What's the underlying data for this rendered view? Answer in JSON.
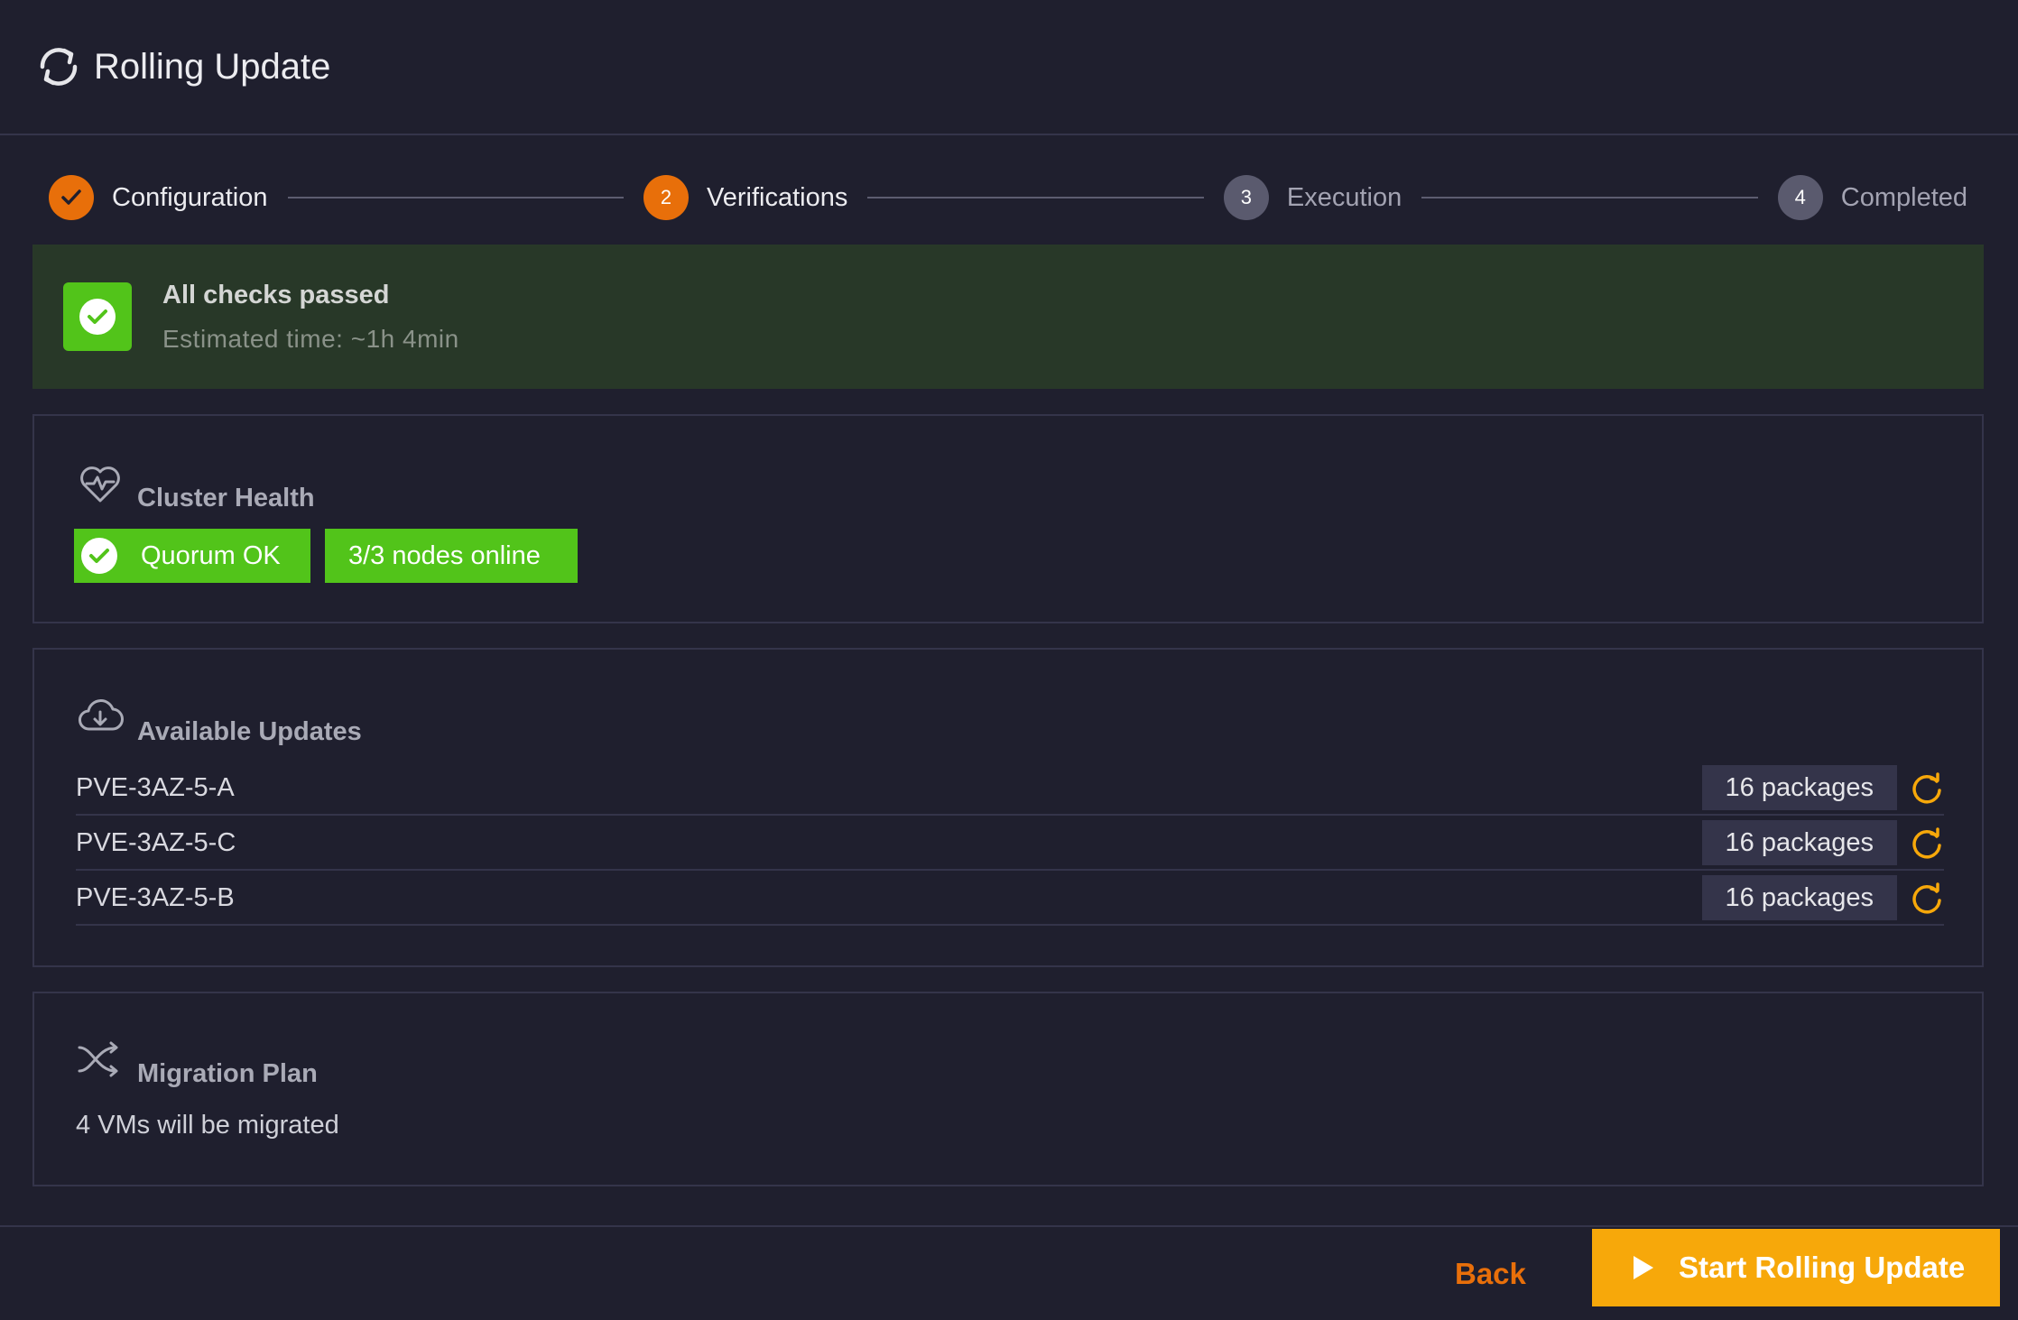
{
  "header": {
    "title": "Rolling Update",
    "icon": "refresh-icon"
  },
  "stepper": {
    "steps": [
      {
        "number": "1",
        "label": "Configuration",
        "state": "done"
      },
      {
        "number": "2",
        "label": "Verifications",
        "state": "active"
      },
      {
        "number": "3",
        "label": "Execution",
        "state": "pending"
      },
      {
        "number": "4",
        "label": "Completed",
        "state": "pending"
      }
    ]
  },
  "banner": {
    "title": "All checks passed",
    "subtitle": "Estimated time: ~1h 4min",
    "icon": "check-circle-icon"
  },
  "cluster_health": {
    "title": "Cluster Health",
    "icon": "heartbeat-icon",
    "quorum_label": "Quorum OK",
    "nodes_label": "3/3 nodes online"
  },
  "available_updates": {
    "title": "Available Updates",
    "icon": "cloud-download-icon",
    "rows": [
      {
        "node": "PVE-3AZ-5-A",
        "packages": "16 packages"
      },
      {
        "node": "PVE-3AZ-5-C",
        "packages": "16 packages"
      },
      {
        "node": "PVE-3AZ-5-B",
        "packages": "16 packages"
      }
    ]
  },
  "migration_plan": {
    "title": "Migration Plan",
    "icon": "shuffle-icon",
    "text": "4 VMs will be migrated"
  },
  "footer": {
    "back_label": "Back",
    "start_label": "Start Rolling Update"
  },
  "colors": {
    "background": "#1f1f2e",
    "accent_orange": "#e86f0a",
    "success_green": "#52c41a",
    "banner_green": "#283828",
    "button_yellow": "#f7a80a",
    "border": "#34344a"
  }
}
